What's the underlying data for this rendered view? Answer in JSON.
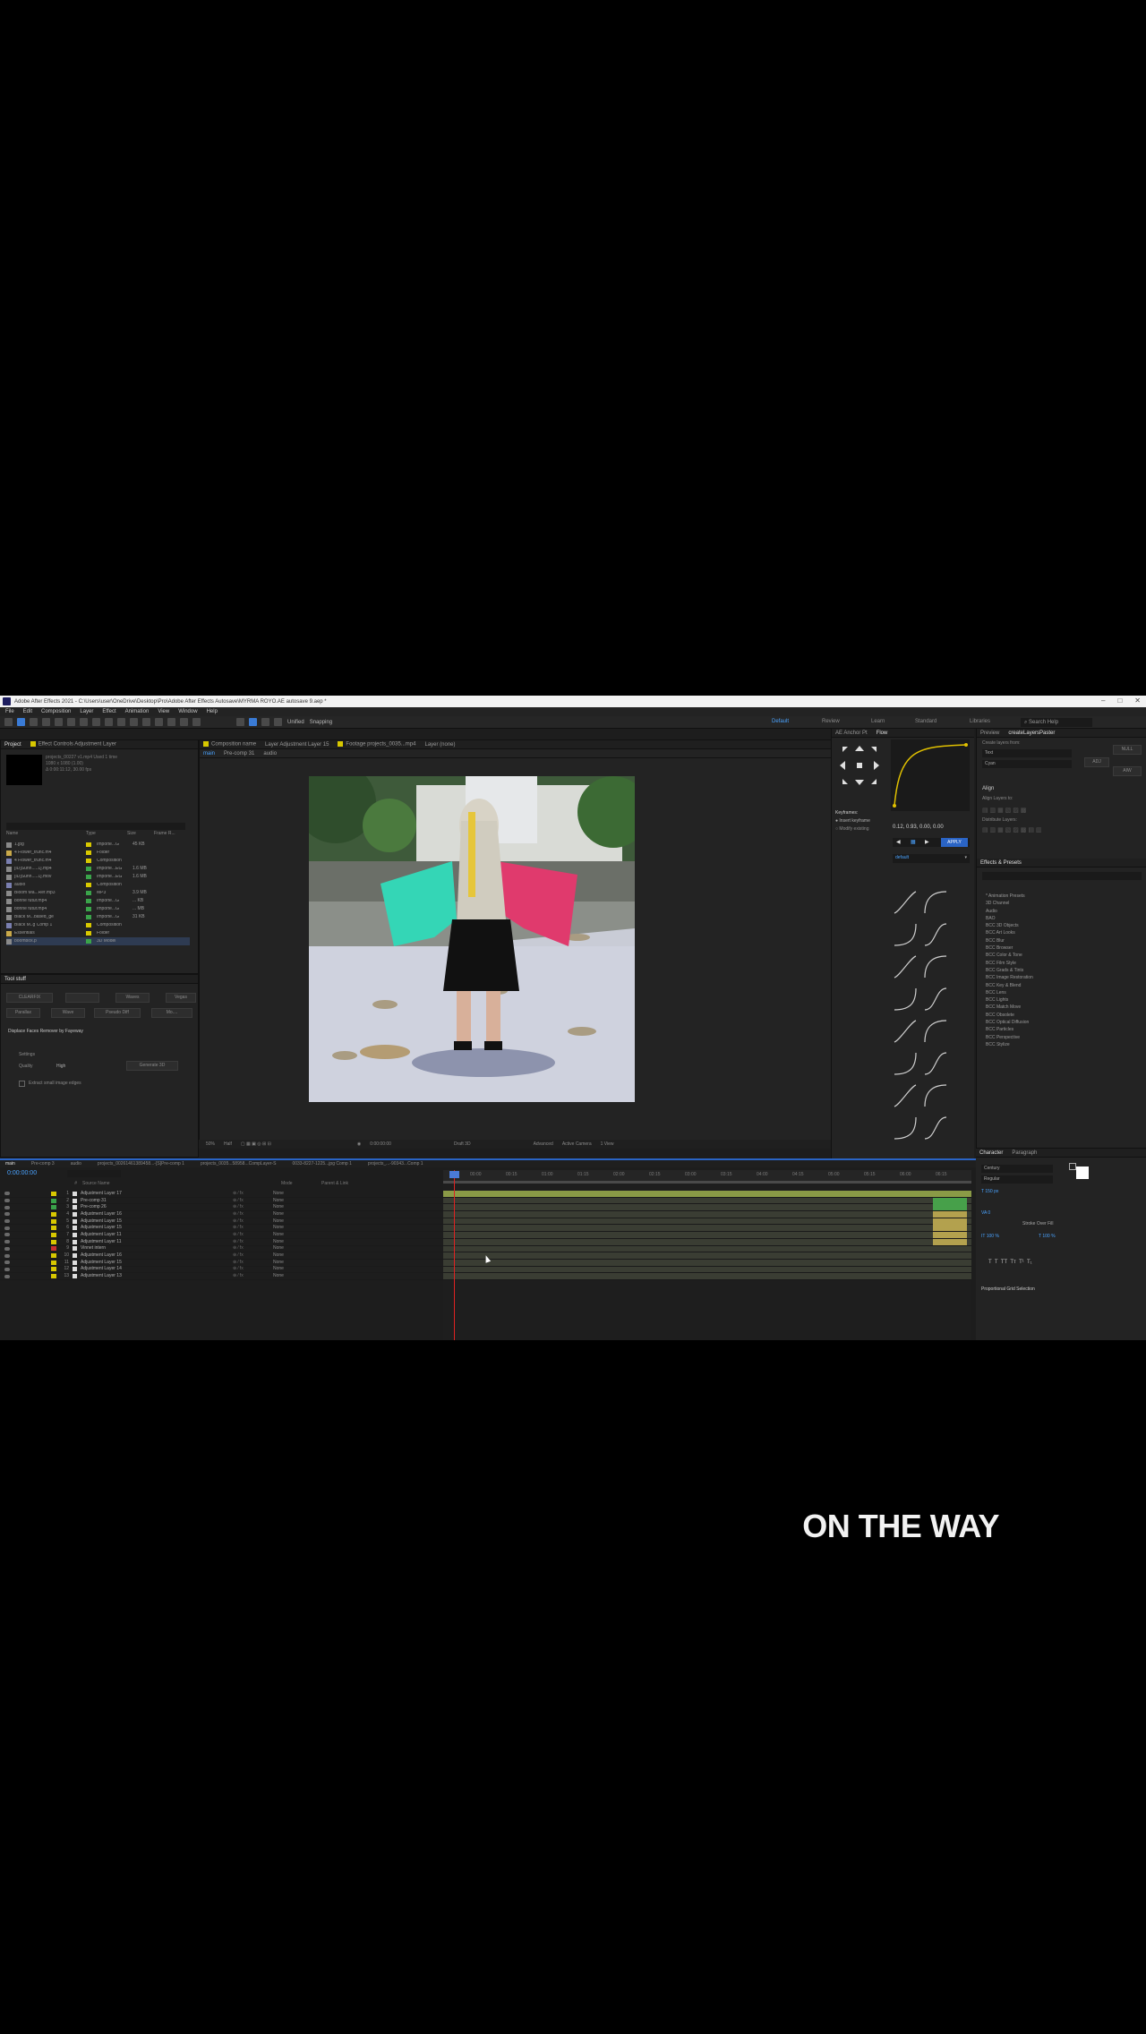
{
  "window": {
    "title": "Adobe After Effects 2021 - C:\\Users\\user\\OneDrive\\Desktop\\Pro\\Adobe After Effects Autosave\\MYRMA ROYO.AE autosave 9.aep *"
  },
  "menu": [
    "File",
    "Edit",
    "Composition",
    "Layer",
    "Effect",
    "Animation",
    "View",
    "Window",
    "Help"
  ],
  "toolbar": {
    "unified_label": "Unified",
    "snapping_label": "Snapping",
    "workspaces": [
      "Default",
      "Review",
      "Learn",
      "Standard",
      "Libraries"
    ],
    "search_placeholder": "Search Help"
  },
  "project_panel": {
    "tabs": [
      "Project",
      "Effect Controls Adjustment Layer"
    ],
    "info": [
      "projects_00227 v1.mp4  Used 1 time",
      "1080 x 1080 (1.00)",
      "Δ 0:00:11:12, 30.00 fps"
    ],
    "columns": [
      "Name",
      "Type",
      "Size",
      "Frame R..."
    ],
    "items": [
      {
        "name": "1.jpg",
        "type": "Importe...G",
        "size": "45 KB",
        "color": "#d8c800",
        "selected": false
      },
      {
        "name": "4 Flower_trunc.m4",
        "type": "Folder",
        "size": "",
        "color": "#d8c800",
        "selected": false
      },
      {
        "name": "4 Flower_trunc.m4",
        "type": "Composition",
        "size": "",
        "color": "#d8c800",
        "selected": false
      },
      {
        "name": "[ID]Sunn.....1].mp4",
        "type": "Importe...EG",
        "size": "1.6 MB",
        "color": "#3aa34a",
        "selected": false
      },
      {
        "name": "[ID]Sunn.....1].mov",
        "type": "Importe...EG",
        "size": "1.6 MB",
        "color": "#3aa34a",
        "selected": false
      },
      {
        "name": "audio",
        "type": "Composition",
        "size": "",
        "color": "#d8c800",
        "selected": false
      },
      {
        "name": "Bloom Ma...Ref.mp3",
        "type": "MP3",
        "size": "3.9 MB",
        "color": "#3aa34a",
        "selected": false
      },
      {
        "name": "bonne futur.mp4",
        "type": "Importe...G",
        "size": "... KB",
        "color": "#3aa34a",
        "selected": false
      },
      {
        "name": "bonne futur.mp4",
        "type": "Importe...G",
        "size": "... MB",
        "color": "#3aa34a",
        "selected": false
      },
      {
        "name": "Black M...based_ge",
        "type": "Importe...G",
        "size": "31 KB",
        "color": "#3aa34a",
        "selected": false
      },
      {
        "name": "Black M..g Comp 1",
        "type": "Composition",
        "size": "",
        "color": "#d8c800",
        "selected": false
      },
      {
        "name": "Essentials",
        "type": "Folder",
        "size": "",
        "color": "#d8c800",
        "selected": false
      },
      {
        "name": "boombox.p",
        "type": "3D Model",
        "size": "",
        "color": "#3aa34a",
        "selected": true
      }
    ],
    "buttons": [
      "CLEARFIX",
      "",
      "Waves",
      "Vegas",
      "Parallax",
      "Wave",
      "Pseudo Diff",
      "Mo...."
    ],
    "section_label": "Displace Faces Remover by Fayeway",
    "settings_label": "Settings",
    "quality_label": "Quality",
    "quality_value": "High",
    "export_button": "Generate 3D",
    "checkbox_label": "Extract small image edges"
  },
  "composition_panel": {
    "tabs": [
      "Composition name",
      "Layer Adjustment Layer 15",
      "Footage projects_0035...mp4",
      "Layer (none)"
    ],
    "subtabs": [
      "main",
      "Pre-comp 31",
      "audio"
    ],
    "zoom": "50%",
    "resolution": "Half",
    "timecode": "0:00:00:00",
    "depth": "Draft 3D",
    "renderer": "Advanced",
    "camera": "Active Camera",
    "views": "1 View"
  },
  "curve_panel": {
    "tabs": [
      "AE Anchor Pt",
      "Flow"
    ],
    "keyframes_title": "Keyframes:",
    "option1": "Insert keyframe",
    "option2": "Modify existing",
    "values": "0.12, 0.93, 0.00, 0.00",
    "apply_label": "APPLY",
    "preset_label": "default"
  },
  "right_panel": {
    "preview_tab": "Preview",
    "create_tab": "createLayersPaster",
    "create_label": "Create layers from:",
    "options": [
      "Text",
      "Cyan"
    ],
    "side_buttons": [
      "NULL",
      "ADJ",
      "AIW"
    ],
    "align_label": "Align",
    "align_to": "Align Layers to:",
    "distribute": "Distribute Layers:",
    "effects_tab": "Effects & Presets",
    "effects": [
      "* Animation Presets",
      "3D Channel",
      "Audio",
      "BAO",
      "BCC 3D Objects",
      "BCC Art Looks",
      "BCC Blur",
      "BCC Browser",
      "BCC Color & Tone",
      "BCC Film Style",
      "BCC Grads & Tints",
      "BCC Image Restoration",
      "BCC Key & Blend",
      "BCC Lens",
      "BCC Lights",
      "BCC Match Move",
      "BCC Obsolete",
      "BCC Optical Diffusion",
      "BCC Particles",
      "BCC Perspective",
      "BCC Stylize"
    ]
  },
  "character_panel": {
    "tabs": [
      "Character",
      "Paragraph"
    ],
    "font": "Century",
    "style": "Regular",
    "size": "150 px",
    "tracking": "0",
    "scale_v": "100 %",
    "scale_h": "100 %",
    "stroke": "Stroke Over Fill",
    "footer": "Proportional Grid Selection"
  },
  "timeline": {
    "tabs": [
      "main",
      "Pre-comp 3",
      "audio",
      "projects_00261461389458...-[S]Pre-comp 1",
      "projects_0035...58958...CompLayer-S",
      "0033-8227-1225...jpg Comp 1",
      "projects_...-90343...Comp 1"
    ],
    "timecode": "0:00:00:00",
    "columns": [
      "#",
      "Source Name",
      "Mode",
      "Parent & Link"
    ],
    "layers": [
      {
        "num": "1",
        "name": "Adjustment Layer 17",
        "color": "#d8c800",
        "mode": "None"
      },
      {
        "num": "2",
        "name": "Pre-comp 31",
        "color": "#3aa34a",
        "mode": "None"
      },
      {
        "num": "3",
        "name": "Pre-comp 26",
        "color": "#3aa34a",
        "mode": "None"
      },
      {
        "num": "4",
        "name": "Adjustment Layer 16",
        "color": "#d8c800",
        "mode": "None"
      },
      {
        "num": "5",
        "name": "Adjustment Layer 15",
        "color": "#d8c800",
        "mode": "None"
      },
      {
        "num": "6",
        "name": "Adjustment Layer 15",
        "color": "#d8c800",
        "mode": "None"
      },
      {
        "num": "7",
        "name": "Adjustment Layer 11",
        "color": "#d8c800",
        "mode": "None"
      },
      {
        "num": "8",
        "name": "Adjustment Layer 11",
        "color": "#d8c800",
        "mode": "None"
      },
      {
        "num": "9",
        "name": "Vinnet intern",
        "color": "#c83030",
        "mode": "None"
      },
      {
        "num": "10",
        "name": "Adjustment Layer 16",
        "color": "#d8c800",
        "mode": "None"
      },
      {
        "num": "11",
        "name": "Adjustment Layer 15",
        "color": "#d8c800",
        "mode": "None"
      },
      {
        "num": "12",
        "name": "Adjustment Layer 14",
        "color": "#d8c800",
        "mode": "None"
      },
      {
        "num": "13",
        "name": "Adjustment Layer 13",
        "color": "#d8c800",
        "mode": "None"
      }
    ],
    "ruler_marks": [
      "00:00",
      "00:15",
      "01:00",
      "01:15",
      "02:00",
      "02:15",
      "03:00",
      "03:15",
      "04:00",
      "04:15",
      "05:00",
      "05:15",
      "06:00",
      "06:15"
    ]
  },
  "caption": "ON THE WAY"
}
